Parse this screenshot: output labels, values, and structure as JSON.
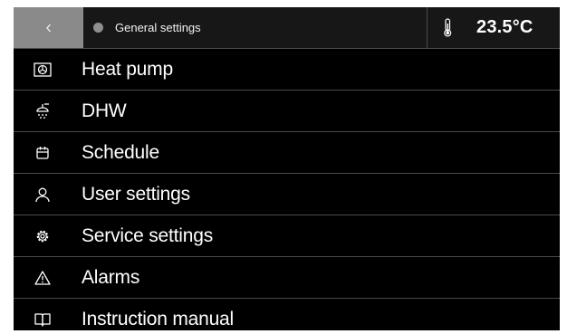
{
  "header": {
    "back_icon": "chevron-left-icon",
    "title": "General settings",
    "temperature": "23.5°C",
    "thermometer_icon": "thermometer-icon"
  },
  "menu": {
    "items": [
      {
        "label": "Heat pump",
        "icon": "heat-pump-icon"
      },
      {
        "label": "DHW",
        "icon": "shower-icon"
      },
      {
        "label": "Schedule",
        "icon": "calendar-icon"
      },
      {
        "label": "User settings",
        "icon": "user-icon"
      },
      {
        "label": "Service settings",
        "icon": "gear-icon"
      },
      {
        "label": "Alarms",
        "icon": "warning-icon"
      },
      {
        "label": "Instruction manual",
        "icon": "book-icon"
      }
    ]
  },
  "colors": {
    "background": "#000000",
    "header": "#171717",
    "back_button": "#8a8a8a",
    "divider": "#4b4b4b",
    "text": "#ffffff"
  }
}
